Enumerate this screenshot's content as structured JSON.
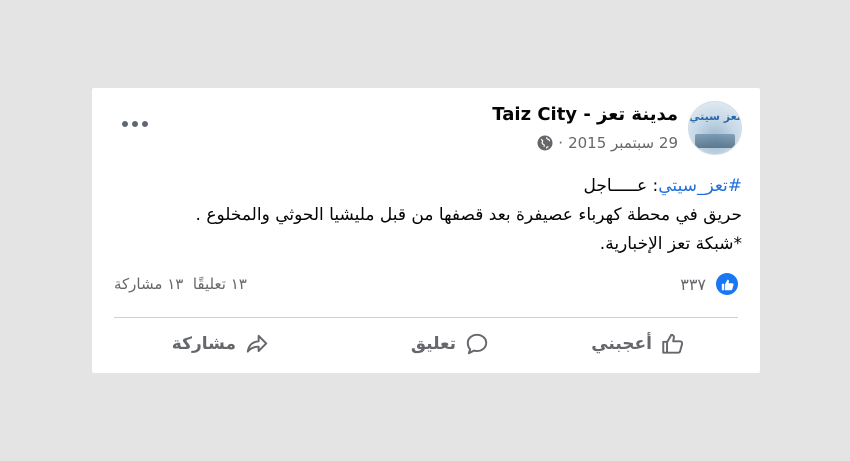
{
  "post": {
    "page_name": "مدينة تعز - Taiz City",
    "date": "29 سبتمبر 2015",
    "separator": "·",
    "avatar_text": "تعز سيتي",
    "hashtag": "#تعز_سيتي",
    "headline_rest": ": عـــــاجل",
    "body_line1": "حريق في محطة كهرباء عصيفرة بعد قصفها من قبل مليشيا الحوثي والمخلوع .",
    "body_line2": "*شبكة تعز الإخبارية."
  },
  "stats": {
    "likes": "٣٣٧",
    "comments": "١٣ تعليقًا",
    "shares": "١٣ مشاركة"
  },
  "actions": {
    "like": "أعجبني",
    "comment": "تعليق",
    "share": "مشاركة"
  },
  "icons": {
    "audience": "globe-icon",
    "more": "more-options-icon",
    "like_badge": "thumbs-up-badge-icon",
    "like": "thumbs-up-icon",
    "comment": "comment-bubble-icon",
    "share": "share-arrow-icon"
  },
  "colors": {
    "background": "#e4e4e4",
    "card": "#ffffff",
    "hashtag": "#216fdb",
    "like_blue": "#1877f2",
    "muted_text": "#65676b"
  }
}
